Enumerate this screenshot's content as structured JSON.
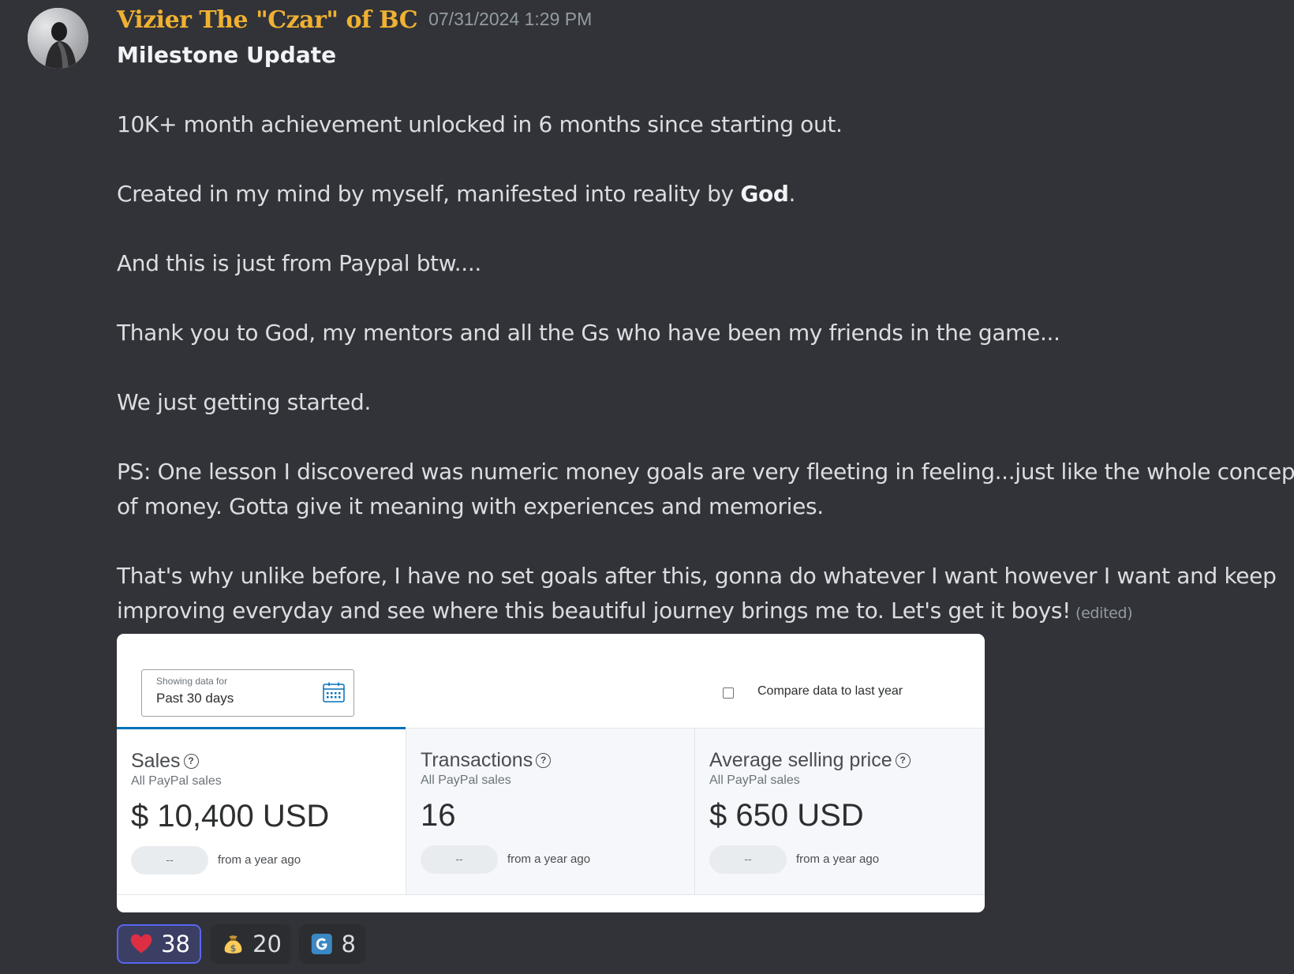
{
  "message": {
    "username": "Vizier The \"Czar\" of BC",
    "timestamp": "07/31/2024 1:29 PM",
    "title": "Milestone Update",
    "paragraphs": {
      "p1": "10K+ month achievement unlocked in 6 months since starting out.",
      "p2_pre": "Created in my mind by myself, manifested into reality by ",
      "p2_bold": "God",
      "p2_post": ".",
      "p3": "And this is just from Paypal btw....",
      "p4": "Thank you to God, my mentors and all the Gs who have been my friends in the game...",
      "p5": "We just getting started.",
      "p6_l1": "PS: One lesson I discovered was numeric money goals are very fleeting in feeling...just like the whole concept",
      "p6_l2": "of money. Gotta give it meaning with experiences and memories.",
      "p7_l1": "That's why unlike before, I have no set goals after this, gonna do whatever I want however I want and keep",
      "p7_l2": "improving everyday and see where this beautiful journey brings me to. Let's get it boys!"
    },
    "edited_label": "(edited)"
  },
  "paypal": {
    "range_label": "Showing data for",
    "range_value": "Past 30 days",
    "compare_label": "Compare data to last year",
    "help_glyph": "?",
    "panels": [
      {
        "title": "Sales",
        "subtitle": "All PayPal sales",
        "value": "$ 10,400 USD",
        "pill": "--",
        "note": "from a year ago"
      },
      {
        "title": "Transactions",
        "subtitle": "All PayPal sales",
        "value": "16",
        "pill": "--",
        "note": "from a year ago"
      },
      {
        "title": "Average selling price",
        "subtitle": "All PayPal sales",
        "value": "$ 650 USD",
        "pill": "--",
        "note": "from a year ago"
      }
    ]
  },
  "reactions": [
    {
      "emoji": "heart-icon",
      "count": "38",
      "active": true
    },
    {
      "emoji": "money-bag-icon",
      "count": "20",
      "active": false
    },
    {
      "emoji": "g-letter-icon",
      "count": "8",
      "active": false
    }
  ],
  "colors": {
    "background": "#313338",
    "username": "#f0b132",
    "accent": "#5865f2",
    "paypal_blue": "#0070ba"
  }
}
